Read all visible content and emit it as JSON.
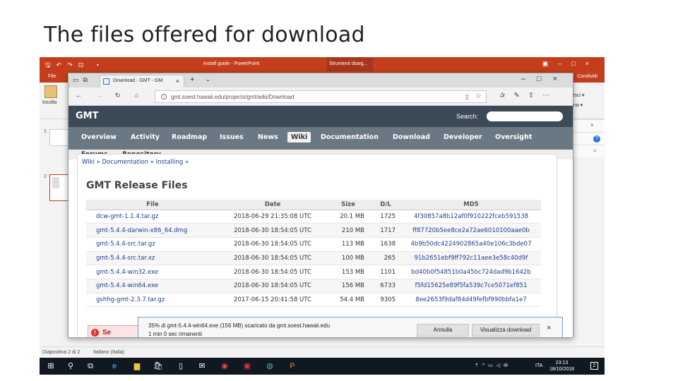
{
  "slide": {
    "title": "The files offered for download"
  },
  "ppt": {
    "window_title": "Install guide - PowerPoint",
    "tools_label": "Strumenti diseg...",
    "file_tab": "File",
    "share": "Condividi",
    "paste": "Incolla",
    "ribbon_right1": "uisci ▾",
    "ribbon_right2": "ona ▾",
    "slide1": "1",
    "slide2": "2",
    "status_slide": "Diapositiva 2 di 2",
    "status_lang": "Italiano (Italia)",
    "help": "?"
  },
  "taskbar": {
    "time": "23:13",
    "date": "18/10/2018",
    "lang": "ITA",
    "notif": "2"
  },
  "browser": {
    "tab_title": "Download - GMT - GM",
    "url": "gmt.soest.hawaii.edu/projects/gmt/wiki/Download"
  },
  "site": {
    "logo": "GMT",
    "search_label": "Search:",
    "menu": [
      "Overview",
      "Activity",
      "Roadmap",
      "Issues",
      "News",
      "Wiki",
      "Documentation",
      "Download",
      "Developer",
      "Oversight"
    ],
    "active_menu": "Wiki",
    "submenu": [
      "Forums",
      "Repository"
    ],
    "breadcrumb": "Wiki » Documentation » Installing »",
    "heading": "GMT Release Files",
    "columns": [
      "File",
      "Date",
      "Size",
      "D/L",
      "MD5"
    ],
    "files": [
      [
        "dcw-gmt-1.1.4.tar.gz",
        "2018-06-29 21:35:08 UTC",
        "20.1 MB",
        "1725",
        "4f30857a8b12af0f910222fceb591538"
      ],
      [
        "gmt-5.4.4-darwin-x86_64.dmg",
        "2018-06-30 18:54:05 UTC",
        "210 MB",
        "1717",
        "ff87720b5ee8ce2a72ae6010100aae0b"
      ],
      [
        "gmt-5.4.4-src.tar.gz",
        "2018-06-30 18:54:05 UTC",
        "113 MB",
        "1638",
        "4b9b50dc4224902865a40e106c3bde07"
      ],
      [
        "gmt-5.4.4-src.tar.xz",
        "2018-06-30 18:54:05 UTC",
        "100 MB",
        "265",
        "91b2651ebf9ff792c11aee3e58c40d9f"
      ],
      [
        "gmt-5.4.4-win32.exe",
        "2018-06-30 18:54:05 UTC",
        "153 MB",
        "1101",
        "bd40b0f54851b0a45bc724dad9b1642b"
      ],
      [
        "gmt-5.4.4-win64.exe",
        "2018-06-30 18:54:05 UTC",
        "156 MB",
        "6733",
        "f5fd15625e89f5fa539c7ce5071ef851"
      ],
      [
        "gshhg-gmt-2.3.7.tar.gz",
        "2017-06-15 20:41:58 UTC",
        "54.4 MB",
        "9305",
        "8ee2653f9daf84d49fefbf990bbfa1e7"
      ]
    ],
    "alert_partial": "Se"
  },
  "download": {
    "line1": "35% di gmt-5.4.4-win64.exe (156 MB) scaricato da gmt.soest.hawaii.edu",
    "line2": "1 min 0 sec rimanenti",
    "cancel": "Annulla",
    "view": "Visualizza download",
    "progress": 0.35
  }
}
